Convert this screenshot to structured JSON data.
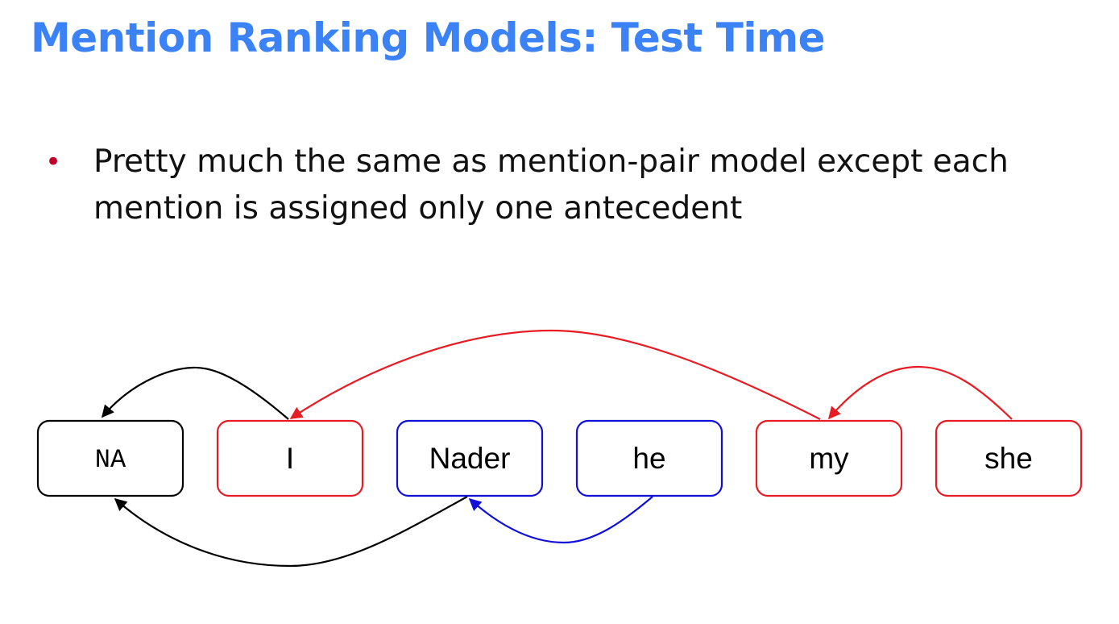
{
  "slide": {
    "title": "Mention Ranking Models: Test Time",
    "bullets": [
      "Pretty much the same as mention-pair model except each mention is assigned only one antecedent"
    ]
  },
  "diagram": {
    "nodes": [
      {
        "id": "na",
        "label": "NA",
        "color": "#000000",
        "monospace": true
      },
      {
        "id": "i",
        "label": "I",
        "color": "#e81c24"
      },
      {
        "id": "nader",
        "label": "Nader",
        "color": "#1010d8"
      },
      {
        "id": "he",
        "label": "he",
        "color": "#1010d8"
      },
      {
        "id": "my",
        "label": "my",
        "color": "#e81c24"
      },
      {
        "id": "she",
        "label": "she",
        "color": "#e81c24"
      }
    ],
    "edges": [
      {
        "from": "i",
        "to": "na",
        "color": "#000000"
      },
      {
        "from": "nader",
        "to": "na",
        "color": "#000000"
      },
      {
        "from": "he",
        "to": "nader",
        "color": "#1010d8"
      },
      {
        "from": "my",
        "to": "i",
        "color": "#e81c24"
      },
      {
        "from": "she",
        "to": "my",
        "color": "#e81c24"
      }
    ]
  }
}
